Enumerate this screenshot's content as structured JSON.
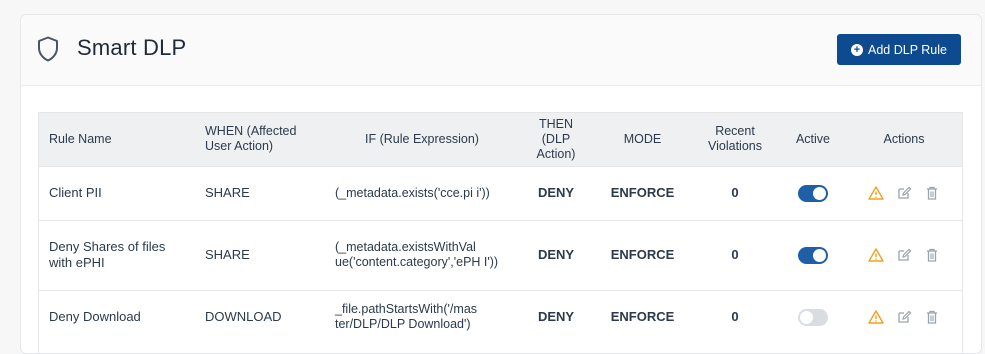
{
  "header": {
    "title": "Smart DLP",
    "add_button_label": "Add DLP Rule"
  },
  "table": {
    "columns": [
      "Rule Name",
      "WHEN (Affected User Action)",
      "IF (Rule Expression)",
      "THEN (DLP Action)",
      "MODE",
      "Recent Violations",
      "Active",
      "Actions"
    ],
    "rows": [
      {
        "name": "Client PII",
        "when": "SHARE",
        "if_expr": "(_metadata.exists('cce.pi i'))",
        "then": "DENY",
        "mode": "ENFORCE",
        "violations": "0",
        "active": true
      },
      {
        "name": "Deny Shares of files with ePHI",
        "when": "SHARE",
        "if_expr": "(_metadata.existsWithVal ue('content.category','ePH I'))",
        "then": "DENY",
        "mode": "ENFORCE",
        "violations": "0",
        "active": true
      },
      {
        "name": "Deny Download",
        "when": "DOWNLOAD",
        "if_expr": "_file.pathStartsWith('/mas ter/DLP/DLP Download')",
        "then": "DENY",
        "mode": "ENFORCE",
        "violations": "0",
        "active": false
      }
    ]
  },
  "icons": {
    "header": "shield-icon",
    "add": "plus-circle-icon",
    "actions": [
      "warning-icon",
      "edit-icon",
      "trash-icon"
    ]
  },
  "colors": {
    "primary": "#0d4a8f",
    "toggle_on": "#1f5fa8",
    "toggle_off": "#d9dce0",
    "warning": "#f0a020",
    "muted_icon": "#9aa3ad"
  }
}
